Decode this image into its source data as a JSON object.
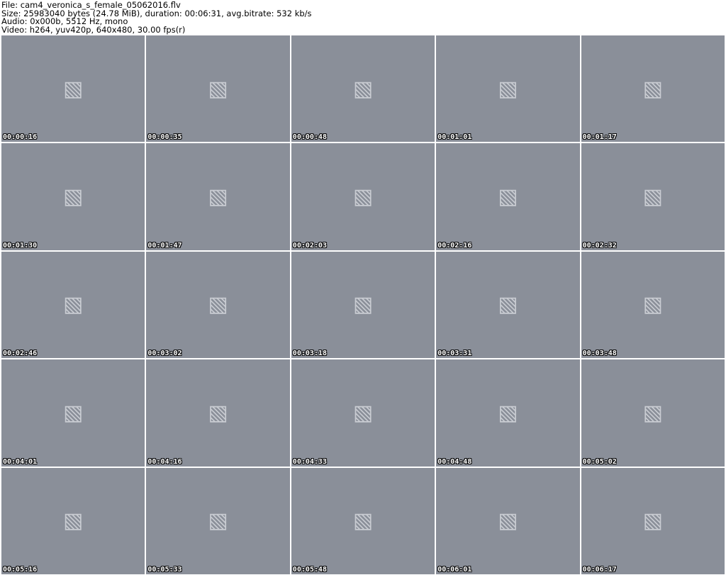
{
  "header": {
    "line1": "File: cam4_veronica_s_female_05062016.flv",
    "line2": "Size: 25983040 bytes (24.78 MiB), duration: 00:06:31, avg.bitrate: 532 kb/s",
    "line3": "Audio: 0x000b, 5512 Hz, mono",
    "line4": "Video: h264, yuv420p, 640x480, 30.00 fps(r)"
  },
  "thumbnails": [
    {
      "timestamp": "00:00:16"
    },
    {
      "timestamp": "00:00:35"
    },
    {
      "timestamp": "00:00:48"
    },
    {
      "timestamp": "00:01:01"
    },
    {
      "timestamp": "00:01:17"
    },
    {
      "timestamp": "00:01:30"
    },
    {
      "timestamp": "00:01:47"
    },
    {
      "timestamp": "00:02:03"
    },
    {
      "timestamp": "00:02:16"
    },
    {
      "timestamp": "00:02:32"
    },
    {
      "timestamp": "00:02:46"
    },
    {
      "timestamp": "00:03:02"
    },
    {
      "timestamp": "00:03:18"
    },
    {
      "timestamp": "00:03:31"
    },
    {
      "timestamp": "00:03:48"
    },
    {
      "timestamp": "00:04:01"
    },
    {
      "timestamp": "00:04:16"
    },
    {
      "timestamp": "00:04:33"
    },
    {
      "timestamp": "00:04:48"
    },
    {
      "timestamp": "00:05:02"
    },
    {
      "timestamp": "00:05:16"
    },
    {
      "timestamp": "00:05:33"
    },
    {
      "timestamp": "00:05:48"
    },
    {
      "timestamp": "00:06:01"
    },
    {
      "timestamp": "00:06:17"
    }
  ],
  "icons": {
    "placeholder": "image-placeholder-icon"
  }
}
